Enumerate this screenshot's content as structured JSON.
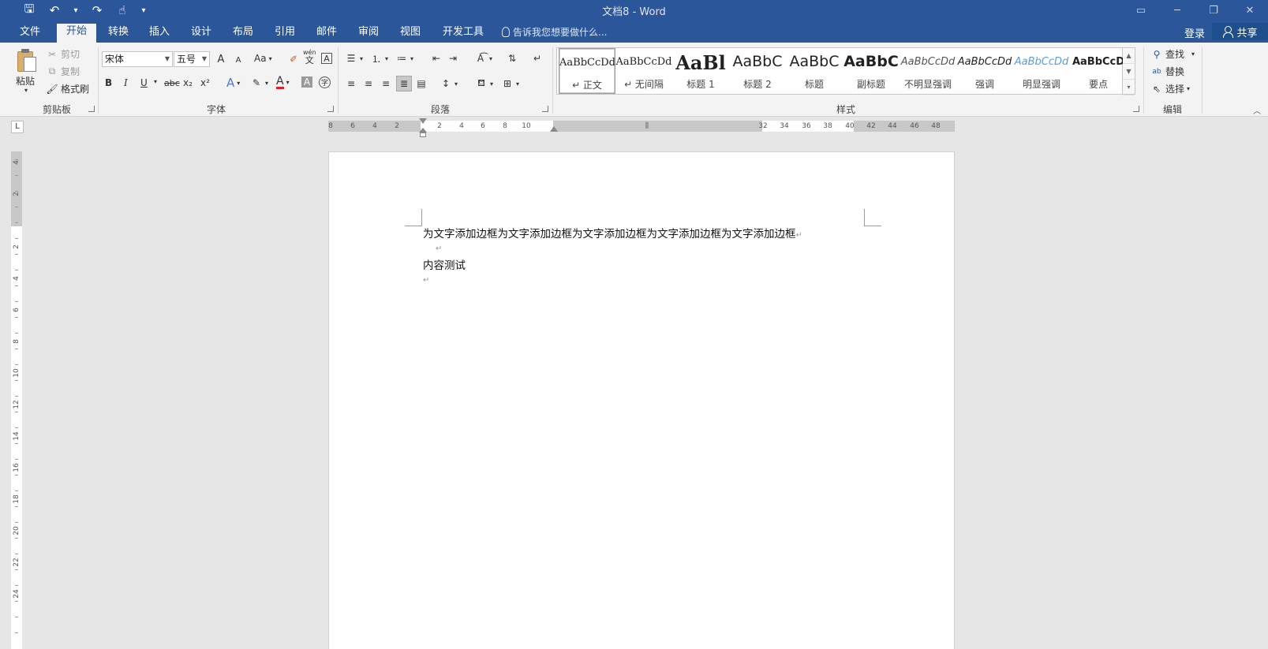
{
  "titlebar": {
    "title": "文档8 - Word",
    "qat_icons": [
      "save-icon",
      "undo-icon",
      "redo-icon",
      "touch-mode-icon",
      "customize-qat-icon"
    ],
    "window_controls": [
      "ribbon-display-icon",
      "minimize-icon",
      "restore-icon",
      "close-icon"
    ]
  },
  "tabs": {
    "file": "文件",
    "home": "开始",
    "convert": "转换",
    "insert": "插入",
    "design": "设计",
    "layout": "布局",
    "references": "引用",
    "mailings": "邮件",
    "review": "审阅",
    "view": "视图",
    "developer": "开发工具",
    "tell_me": "告诉我您想要做什么...",
    "login": "登录",
    "share": "共享"
  },
  "ribbon": {
    "clipboard": {
      "paste": "粘贴",
      "cut": "剪切",
      "copy": "复制",
      "format_painter": "格式刷",
      "label": "剪贴板"
    },
    "font": {
      "font_name": "宋体",
      "font_size": "五号",
      "label": "字体",
      "bold": "B",
      "italic": "I",
      "underline": "U",
      "strike": "abc",
      "subscript": "x₂",
      "superscript": "x²",
      "change_case": "Aa",
      "phonetic": "wén",
      "phonetic_char": "文",
      "char_border": "A",
      "text_effect": "A",
      "font_color": "A",
      "char_shading": "A",
      "enclose": "字",
      "grow": "A",
      "shrink": "A"
    },
    "paragraph": {
      "label": "段落"
    },
    "styles": {
      "label": "样式",
      "items": [
        {
          "sample": "AaBbCcDd",
          "name": "↵ 正文"
        },
        {
          "sample": "AaBbCcDd",
          "name": "↵ 无间隔"
        },
        {
          "sample": "AaBl",
          "name": "标题 1"
        },
        {
          "sample": "AaBbC",
          "name": "标题 2"
        },
        {
          "sample": "AaBbC",
          "name": "标题"
        },
        {
          "sample": "AaBbC",
          "name": "副标题"
        },
        {
          "sample": "AaBbCcDd",
          "name": "不明显强调"
        },
        {
          "sample": "AaBbCcDd",
          "name": "强调"
        },
        {
          "sample": "AaBbCcDd",
          "name": "明显强调"
        },
        {
          "sample": "AaBbCcD",
          "name": "要点"
        }
      ]
    },
    "editing": {
      "find": "查找",
      "replace": "替换",
      "select": "选择",
      "label": "编辑"
    }
  },
  "ruler": {
    "h_numbers": [
      "8",
      "6",
      "4",
      "2",
      "2",
      "4",
      "6",
      "8",
      "10",
      "32",
      "34",
      "36",
      "38",
      "40",
      "42",
      "44",
      "46",
      "48"
    ],
    "v_numbers": [
      "4",
      "2",
      "2",
      "4",
      "6",
      "8",
      "10",
      "12",
      "14",
      "16",
      "18",
      "20",
      "22",
      "24"
    ],
    "tab_selector": "L"
  },
  "document": {
    "paragraphs": [
      "为文字添加边框为文字添加边框为文字添加边框为文字添加边框为文字添加边框",
      "",
      "内容测试",
      ""
    ],
    "para_mark": "↵"
  },
  "colors": {
    "accent": "#2b579a",
    "ribbon_bg": "#f3f3f3",
    "canvas_bg": "#e6e6e6"
  }
}
